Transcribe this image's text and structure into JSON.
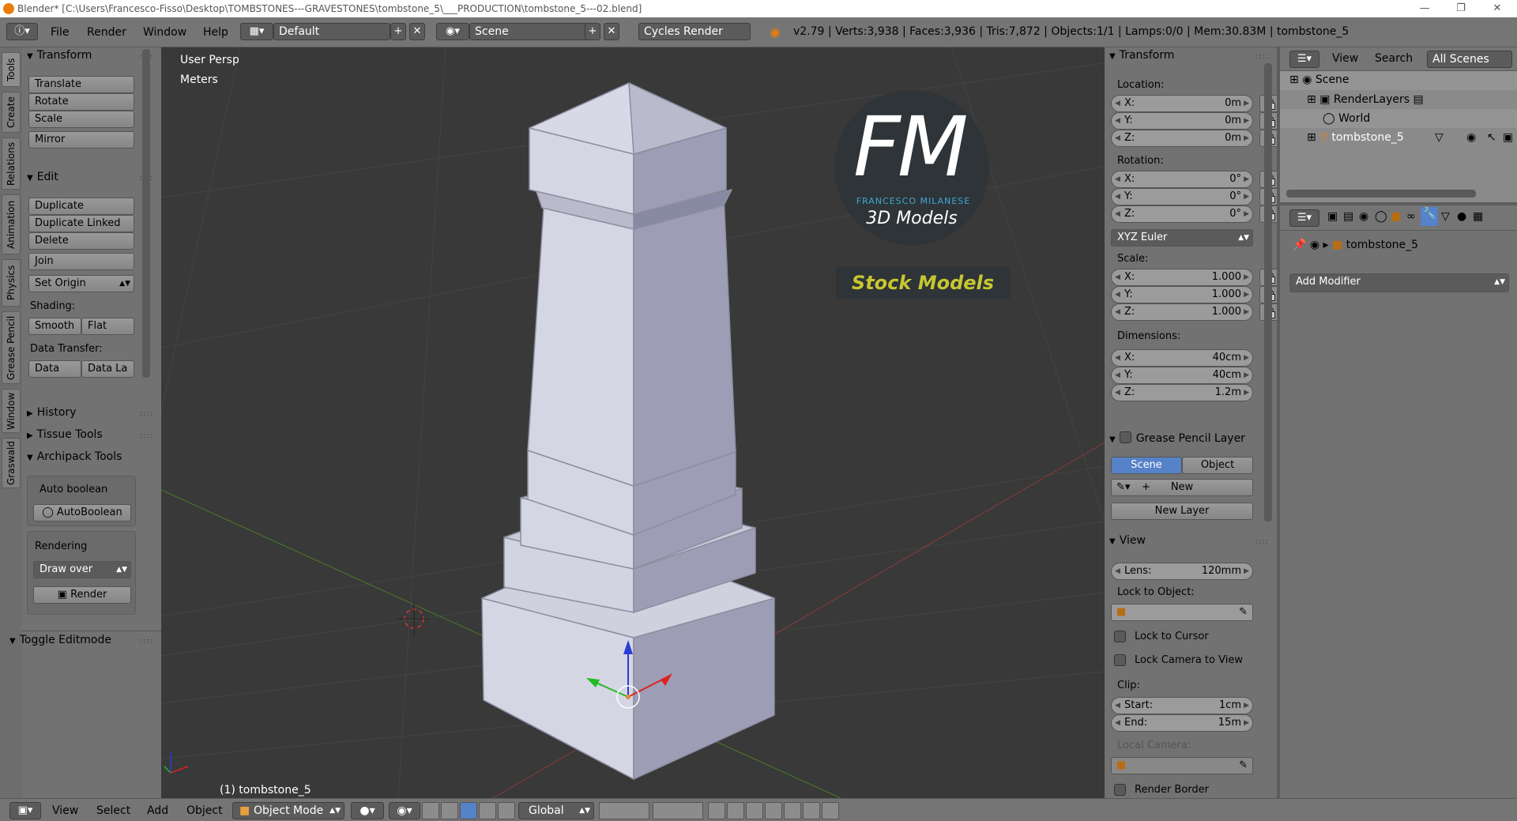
{
  "window": {
    "title": "Blender* [C:\\Users\\Francesco-Fisso\\Desktop\\TOMBSTONES---GRAVESTONES\\tombstone_5\\___PRODUCTION\\tombstone_5---02.blend]"
  },
  "info_header": {
    "menus": [
      "File",
      "Render",
      "Window",
      "Help"
    ],
    "screen_layout": "Default",
    "scene": "Scene",
    "render_engine": "Cycles Render",
    "stats": "v2.79 | Verts:3,938 | Faces:3,936 | Tris:7,872 | Objects:1/1 | Lamps:0/0 | Mem:30.83M | tombstone_5"
  },
  "side_tabs": [
    "Tools",
    "Create",
    "Relations",
    "Animation",
    "Physics",
    "Grease Pencil",
    "Window",
    "Graswald"
  ],
  "tool_shelf": {
    "transform_header": "Transform",
    "transform_buttons": [
      "Translate",
      "Rotate",
      "Scale",
      "Mirror"
    ],
    "edit_header": "Edit",
    "edit_buttons": [
      "Duplicate",
      "Duplicate Linked",
      "Delete",
      "Join"
    ],
    "set_origin": "Set Origin",
    "shading_label": "Shading:",
    "shading_smooth": "Smooth",
    "shading_flat": "Flat",
    "data_transfer_label": "Data Transfer:",
    "data_btn": "Data",
    "data_la_btn": "Data La",
    "history": "History",
    "tissue_tools": "Tissue Tools",
    "archipack": "Archipack Tools",
    "auto_boolean_label": "Auto boolean",
    "auto_boolean_btn": "AutoBoolean",
    "rendering_label": "Rendering",
    "draw_over": "Draw over",
    "render_btn": "Render",
    "toggle_editmode": "Toggle Editmode"
  },
  "viewport": {
    "view_name": "User Persp",
    "units": "Meters",
    "object_label": "(1) tombstone_5",
    "watermark": {
      "logo": "FM",
      "brand": "FRANCESCO MILANESE",
      "subtitle": "3D Models",
      "tag": "Stock Models"
    }
  },
  "properties_panel": {
    "transform_header": "Transform",
    "location_label": "Location:",
    "location": [
      {
        "k": "X:",
        "v": "0m"
      },
      {
        "k": "Y:",
        "v": "0m"
      },
      {
        "k": "Z:",
        "v": "0m"
      }
    ],
    "rotation_label": "Rotation:",
    "rotation": [
      {
        "k": "X:",
        "v": "0°"
      },
      {
        "k": "Y:",
        "v": "0°"
      },
      {
        "k": "Z:",
        "v": "0°"
      }
    ],
    "rotation_mode": "XYZ Euler",
    "scale_label": "Scale:",
    "scale": [
      {
        "k": "X:",
        "v": "1.000"
      },
      {
        "k": "Y:",
        "v": "1.000"
      },
      {
        "k": "Z:",
        "v": "1.000"
      }
    ],
    "dimensions_label": "Dimensions:",
    "dimensions": [
      {
        "k": "X:",
        "v": "40cm"
      },
      {
        "k": "Y:",
        "v": "40cm"
      },
      {
        "k": "Z:",
        "v": "1.2m"
      }
    ],
    "grease_header": "Grease Pencil Layer",
    "gp_scene": "Scene",
    "gp_object": "Object",
    "gp_new": "New",
    "gp_new_layer": "New Layer",
    "view_header": "View",
    "lens_k": "Lens:",
    "lens_v": "120mm",
    "lock_to_object": "Lock to Object:",
    "lock_to_cursor": "Lock to Cursor",
    "lock_camera": "Lock Camera to View",
    "clip_label": "Clip:",
    "clip_start_k": "Start:",
    "clip_start_v": "1cm",
    "clip_end_k": "End:",
    "clip_end_v": "15m",
    "local_camera": "Local Camera:",
    "render_border": "Render Border"
  },
  "outliner": {
    "menu_view": "View",
    "menu_search": "Search",
    "filter": "All Scenes",
    "items": [
      "Scene",
      "RenderLayers",
      "World",
      "tombstone_5"
    ]
  },
  "properties_editor": {
    "object_name": "tombstone_5",
    "add_modifier": "Add Modifier"
  },
  "bottom_bar": {
    "menus": [
      "View",
      "Select",
      "Add",
      "Object"
    ],
    "mode": "Object Mode",
    "orientation": "Global"
  }
}
